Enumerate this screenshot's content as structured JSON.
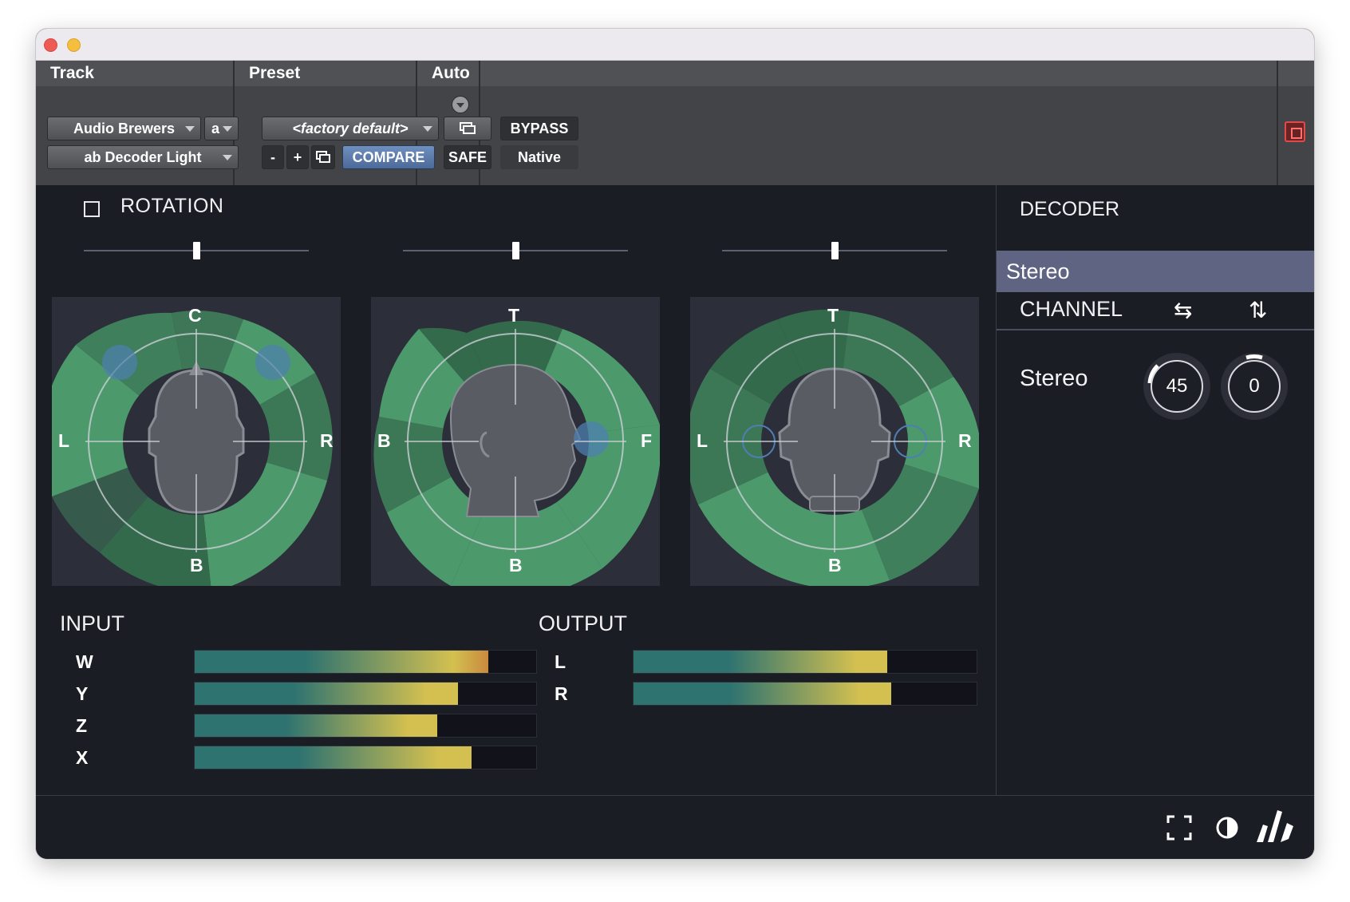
{
  "host": {
    "track_header": "Track",
    "preset_header": "Preset",
    "auto_header": "Auto",
    "track_name": "Audio Brewers",
    "track_channel": "a",
    "plugin_name": "ab Decoder Light",
    "preset_name": "<factory default>",
    "minus": "-",
    "plus": "+",
    "compare": "COMPARE",
    "safe": "SAFE",
    "bypass": "BYPASS",
    "native": "Native"
  },
  "rotation": {
    "label": "ROTATION",
    "enabled": false,
    "sliders": [
      0.5,
      0.5,
      0.5
    ]
  },
  "scopes": [
    {
      "top": "C",
      "left": "L",
      "right": "R",
      "bottom": "B"
    },
    {
      "top": "T",
      "left": "B",
      "right": "F",
      "bottom": "B"
    },
    {
      "top": "T",
      "left": "L",
      "right": "R",
      "bottom": "B"
    }
  ],
  "input": {
    "title": "INPUT",
    "channels": [
      {
        "label": "W",
        "level": 0.86
      },
      {
        "label": "Y",
        "level": 0.77
      },
      {
        "label": "Z",
        "level": 0.71
      },
      {
        "label": "X",
        "level": 0.81
      }
    ]
  },
  "output": {
    "title": "OUTPUT",
    "channels": [
      {
        "label": "L",
        "level": 0.74
      },
      {
        "label": "R",
        "level": 0.75
      }
    ]
  },
  "decoder": {
    "title": "DECODER",
    "selected": "Stereo",
    "channel_title": "CHANNEL",
    "swap_icon": "swap-horizontal-icon",
    "flip_icon": "swap-vertical-icon",
    "row_label": "Stereo",
    "width_value": "45",
    "rotation_value": "0"
  },
  "footer": {
    "icons": [
      "fullscreen-icon",
      "contrast-icon",
      "audio-brewers-logo"
    ]
  },
  "colors": {
    "accent_green": "#4c9a6c",
    "meter_start": "#2f7370",
    "meter_mid": "#d3c050",
    "meter_hot": "#c98a3e",
    "selected_row": "#5f6483"
  }
}
